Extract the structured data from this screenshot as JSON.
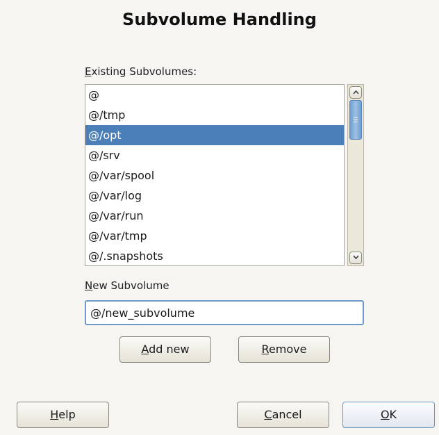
{
  "dialog": {
    "title": "Subvolume Handling"
  },
  "existing": {
    "label_mnemonic": "E",
    "label_rest": "xisting Subvolumes:",
    "items": [
      "@",
      "@/tmp",
      "@/opt",
      "@/srv",
      "@/var/spool",
      "@/var/log",
      "@/var/run",
      "@/var/tmp",
      "@/.snapshots"
    ],
    "selected_index": 2
  },
  "new_subvolume": {
    "label_mnemonic": "N",
    "label_rest": "ew Subvolume",
    "value": "@/new_subvolume"
  },
  "buttons": {
    "add_mnemonic": "A",
    "add_rest": "dd new",
    "remove_mnemonic": "R",
    "remove_rest": "emove",
    "help_mnemonic": "H",
    "help_rest": "elp",
    "cancel_mnemonic": "C",
    "cancel_rest": "ancel",
    "ok_mnemonic": "O",
    "ok_rest": "K"
  },
  "colors": {
    "selection": "#4a7fb8",
    "background": "#f6f5f2"
  }
}
